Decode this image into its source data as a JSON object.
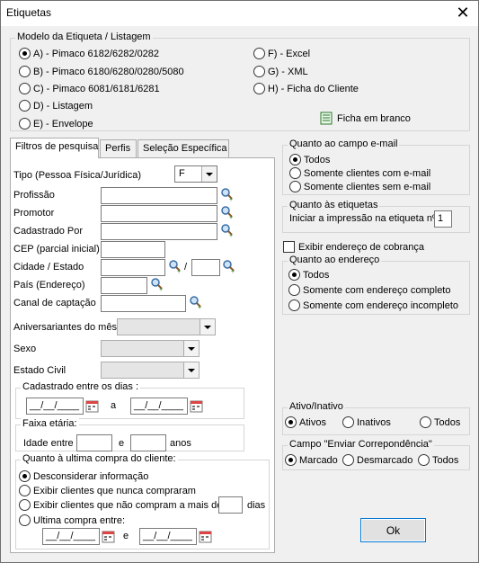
{
  "window": {
    "title": "Etiquetas",
    "close": "✕"
  },
  "modelo": {
    "legend": "Modelo da Etiqueta / Listagem",
    "left": [
      {
        "label": "A) - Pimaco 6182/6282/0282",
        "on": true
      },
      {
        "label": "B) - Pimaco 6180/6280/0280/5080",
        "on": false
      },
      {
        "label": "C) - Pimaco 6081/6181/6281",
        "on": false
      },
      {
        "label": "D) - Listagem",
        "on": false
      },
      {
        "label": "E) - Envelope",
        "on": false
      }
    ],
    "right": [
      {
        "label": "F) - Excel",
        "on": false
      },
      {
        "label": "G) - XML",
        "on": false
      },
      {
        "label": "H) - Ficha do Cliente",
        "on": false
      }
    ],
    "ficha_branco": "Ficha em branco"
  },
  "tabs": [
    "Filtros de pesquisa",
    "Perfis",
    "Seleção Específica"
  ],
  "filtros": {
    "tipo_label": "Tipo (Pessoa Física/Jurídica)",
    "tipo_value": "F",
    "profissao": "Profissão",
    "promotor": "Promotor",
    "cadastrado_por": "Cadastrado Por",
    "cep": "CEP (parcial inicial)",
    "cidade_estado": "Cidade / Estado",
    "slash": "/",
    "pais": "País (Endereço)",
    "canal": "Canal de captação",
    "aniversariantes": "Aniversariantes do mês",
    "sexo": "Sexo",
    "estado_civil": "Estado Civil",
    "cadastrado_legend": "Cadastrado entre os dias :",
    "date_placeholder": "__/__/____",
    "a_label": "a",
    "faixa_legend": "Faixa etária:",
    "idade_entre": "Idade entre",
    "e_label": "e",
    "anos": "anos",
    "compra_legend": "Quanto à ultima compra do cliente:",
    "compra_opts": [
      {
        "label": "Desconsiderar informação",
        "on": true
      },
      {
        "label": "Exibir clientes que nunca compraram",
        "on": false
      },
      {
        "label": "Exibir clientes que não compram a mais de",
        "on": false
      },
      {
        "label": "Ultima compra entre:",
        "on": false
      }
    ],
    "dias": "dias"
  },
  "email": {
    "legend": "Quanto ao campo e-mail",
    "opts": [
      {
        "label": "Todos",
        "on": true
      },
      {
        "label": "Somente clientes com e-mail",
        "on": false
      },
      {
        "label": "Somente clientes sem e-mail",
        "on": false
      }
    ]
  },
  "etiquetas": {
    "legend": "Quanto às etiquetas",
    "label": "Iniciar a impressão na etiqueta nº",
    "value": "1"
  },
  "cobranca": "Exibir endereço de cobrança",
  "endereco": {
    "legend": "Quanto ao endereço",
    "opts": [
      {
        "label": "Todos",
        "on": true
      },
      {
        "label": "Somente com endereço completo",
        "on": false
      },
      {
        "label": "Somente com endereço incompleto",
        "on": false
      }
    ]
  },
  "ativo": {
    "legend": "Ativo/Inativo",
    "opts": [
      {
        "label": "Ativos",
        "on": true
      },
      {
        "label": "Inativos",
        "on": false
      },
      {
        "label": "Todos",
        "on": false
      }
    ]
  },
  "correspondencia": {
    "legend": "Campo \"Enviar Correpondência\"",
    "opts": [
      {
        "label": "Marcado",
        "on": true
      },
      {
        "label": "Desmarcado",
        "on": false
      },
      {
        "label": "Todos",
        "on": false
      }
    ]
  },
  "ok": "Ok"
}
